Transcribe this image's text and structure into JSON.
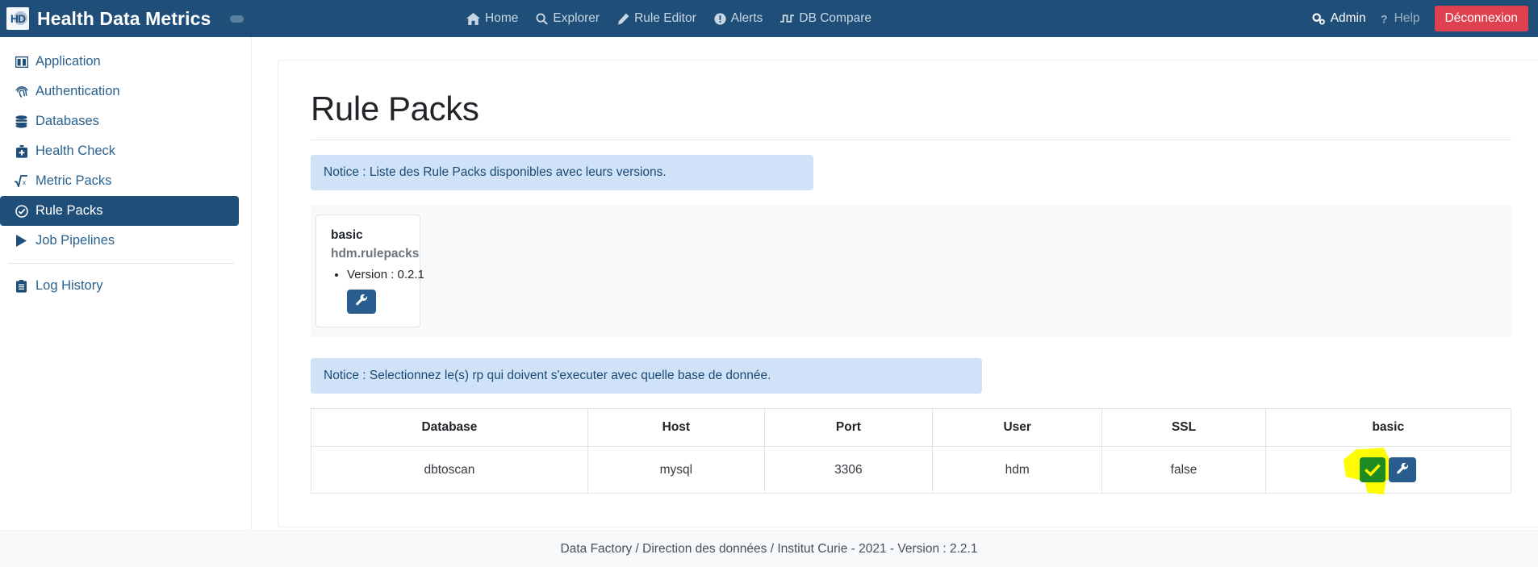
{
  "navbar": {
    "brand": {
      "logo_text": "HD",
      "title": "Health Data Metrics"
    },
    "center_links": [
      {
        "label": "Home",
        "icon": "home-icon"
      },
      {
        "label": "Explorer",
        "icon": "search-icon"
      },
      {
        "label": "Rule Editor",
        "icon": "pencil-icon"
      },
      {
        "label": "Alerts",
        "icon": "exclamation-circle-icon"
      },
      {
        "label": "DB Compare",
        "icon": "wave-square-icon"
      }
    ],
    "right_links": [
      {
        "label": "Admin",
        "icon": "gears-icon"
      },
      {
        "label": "Help",
        "icon": "question-icon"
      }
    ],
    "logout_label": "Déconnexion",
    "accent_color": "#1f4e79",
    "logout_color": "#e04150"
  },
  "sidebar": {
    "items": [
      {
        "label": "Application",
        "icon": "columns-icon",
        "active": false
      },
      {
        "label": "Authentication",
        "icon": "fingerprint-icon",
        "active": false
      },
      {
        "label": "Databases",
        "icon": "database-icon",
        "active": false
      },
      {
        "label": "Health Check",
        "icon": "briefcase-medical-icon",
        "active": false
      },
      {
        "label": "Metric Packs",
        "icon": "square-root-icon",
        "active": false
      },
      {
        "label": "Rule Packs",
        "icon": "check-circle-icon",
        "active": true
      },
      {
        "label": "Job Pipelines",
        "icon": "play-icon",
        "active": false
      },
      {
        "label": "Log History",
        "icon": "clipboard-list-icon",
        "active": false
      }
    ]
  },
  "main": {
    "page_title": "Rule Packs",
    "notice_packs": "Notice : Liste des Rule Packs disponibles avec leurs versions.",
    "notice_select": "Notice : Selectionnez le(s) rp qui doivent s'executer avec quelle base de donnée.",
    "rule_packs": [
      {
        "name": "basic",
        "namespace": "hdm.rulepacks",
        "version_label": "Version : 0.2.1",
        "config_button_icon": "wrench-icon"
      }
    ],
    "table": {
      "headers": [
        "Database",
        "Host",
        "Port",
        "User",
        "SSL",
        "basic"
      ],
      "rows": [
        {
          "database": "dbtoscan",
          "host": "mysql",
          "port": "3306",
          "user": "hdm",
          "ssl": "false",
          "basic_checked": true,
          "basic_check_icon": "check-icon",
          "basic_config_icon": "wrench-icon"
        }
      ]
    }
  },
  "footer": {
    "text": "Data Factory / Direction des données / Institut Curie - 2021 - Version : 2.2.1"
  },
  "annotation": {
    "highlight_color": "#fffb00",
    "check_color": "#1d8a22"
  }
}
